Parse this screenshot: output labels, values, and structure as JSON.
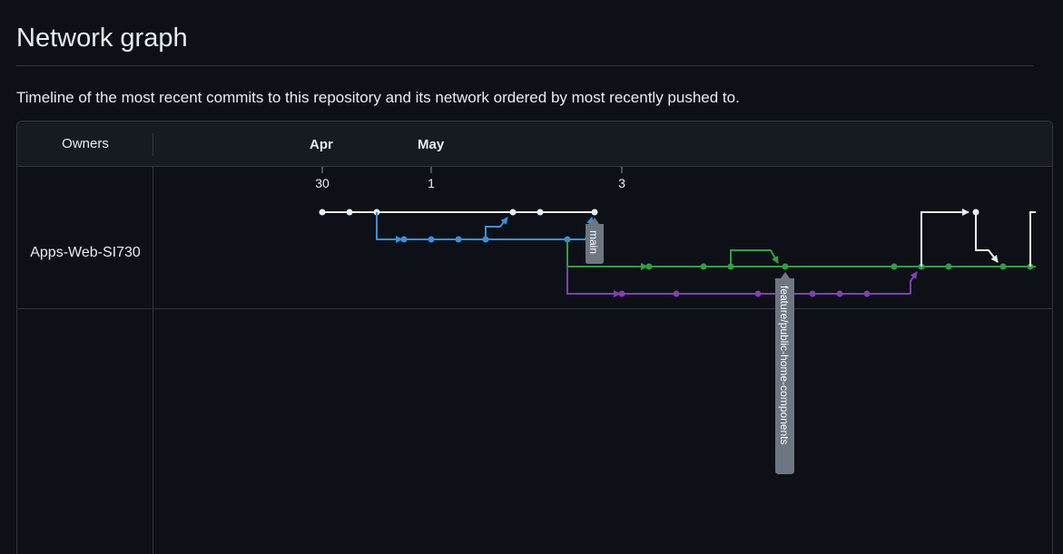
{
  "page": {
    "title": "Network graph",
    "description": "Timeline of the most recent commits to this repository and its network ordered by most recently pushed to."
  },
  "graph": {
    "owners_header": "Owners",
    "months": [
      "Apr",
      "May"
    ],
    "days": [
      "30",
      "1",
      "3"
    ],
    "owner": "Apps-Web-SI730",
    "branch_labels": {
      "main": "main",
      "feature": "feature/public-home-components"
    },
    "colors": {
      "main": "#e6edf3",
      "blue": "#3d8fd6",
      "green": "#2ea043",
      "purple": "#8040b0",
      "label_bg": "#6e7681"
    }
  }
}
